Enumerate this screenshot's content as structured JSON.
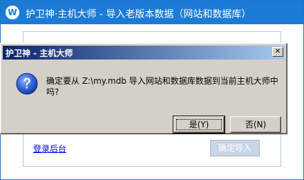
{
  "main_window": {
    "title": "护卫神·主机大师 - 导入老版本数据（网站和数据库）",
    "logo_glyph": "W",
    "admin_link": "登录后台",
    "confirm_import_label": "确定导入"
  },
  "dialog": {
    "title": "护卫神 - 主机大师",
    "close_glyph": "✕",
    "message": "确定要从 Z:\\my.mdb 导入网站和数据库数据到当前主机大师中吗?",
    "yes_label": "是(Y)",
    "no_label": "否(N)"
  },
  "colors": {
    "titlebar_blue": "#1c7bd6",
    "dialog_title_start": "#0a246a",
    "dialog_title_end": "#a6caf0",
    "dialog_face": "#d4d0c8"
  }
}
